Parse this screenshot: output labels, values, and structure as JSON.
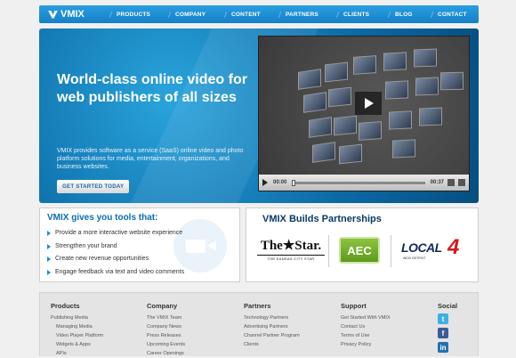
{
  "nav": {
    "logo": "VMIX",
    "items": [
      "PRODUCTS",
      "COMPANY",
      "CONTENT",
      "PARTNERS",
      "CLIENTS",
      "BLOG",
      "CONTACT"
    ]
  },
  "hero": {
    "title": "World-class online video for web publishers of all sizes",
    "description": "VMIX provides software as a service (SaaS) online video and photo platform solutions for media, entertainment, organizations, and business websites.",
    "cta": "GET STARTED TODAY",
    "player": {
      "current_time": "00:00",
      "duration": "00:37"
    }
  },
  "tools": {
    "title": "VMIX gives you tools that:",
    "items": [
      "Provide a more interactive website experience",
      "Strengthen your brand",
      "Create new revenue opportunities",
      "Engage feedback via text and video comments"
    ]
  },
  "partners": {
    "title": "VMIX Builds Partnerships",
    "star": {
      "main": "The★Star.",
      "sub": "THE KANSAS CITY STAR"
    },
    "aec": "AEC",
    "local4": {
      "text": "LOCAL",
      "num": "4",
      "sub": "WDIV DETROIT"
    }
  },
  "footer": {
    "products": {
      "head": "Products",
      "links": [
        "Publishing Media",
        "Managing Media",
        "Video Player Platform",
        "Widgets & Apps",
        "APIs"
      ]
    },
    "company": {
      "head": "Company",
      "links": [
        "The VMIX Team",
        "Company News",
        "Press Releases",
        "Upcoming Events",
        "Career Openings"
      ]
    },
    "partners": {
      "head": "Partners",
      "links": [
        "Technology Partners",
        "Advertising Partners",
        "Channel Partner Program",
        "Clients"
      ]
    },
    "support": {
      "head": "Support",
      "links": [
        "Get Started With VMIX",
        "Contact Us",
        "Terms of Use",
        "Privacy Policy"
      ]
    },
    "social": {
      "head": "Social",
      "icons": [
        "twitter-icon",
        "facebook-icon",
        "linkedin-icon"
      ],
      "colors": [
        "#3bb0e6",
        "#3b5a9a",
        "#1f73b2"
      ]
    }
  }
}
